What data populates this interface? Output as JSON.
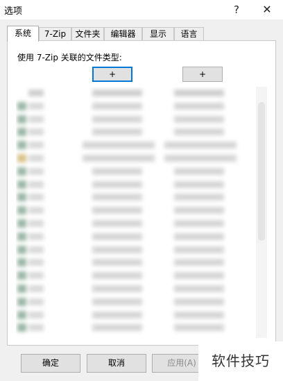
{
  "window": {
    "title": "选项",
    "help_glyph": "?",
    "close_glyph": "✕"
  },
  "tabs": [
    {
      "label": "系统",
      "active": true
    },
    {
      "label": "7-Zip"
    },
    {
      "label": "文件夹"
    },
    {
      "label": "编辑器"
    },
    {
      "label": "显示"
    },
    {
      "label": "语言"
    }
  ],
  "system": {
    "associate_label": "使用 7-Zip 关联的文件类型:",
    "plus_button_1": "+",
    "plus_button_2": "+"
  },
  "footer": {
    "ok_label": "确定",
    "cancel_label": "取消",
    "apply_label": "应用(A)"
  },
  "watermark": "软件技巧"
}
